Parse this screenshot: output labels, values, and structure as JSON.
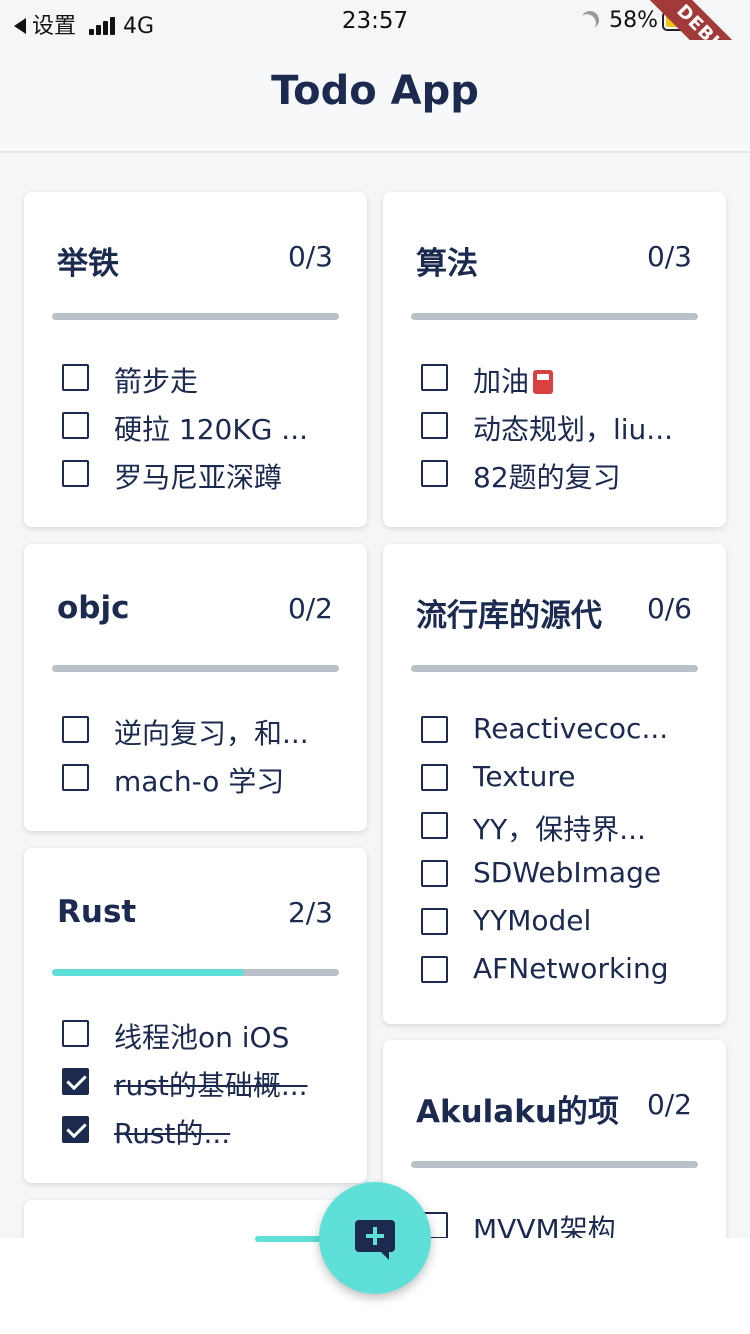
{
  "status_bar": {
    "back_label": "设置",
    "network": "4G",
    "time": "23:57",
    "battery": "58%"
  },
  "debug_banner": "DEBUG",
  "app_bar": {
    "title": "Todo App"
  },
  "colors": {
    "accent": "#5ee0d8",
    "text": "#1b2a4e",
    "progress_bg": "#b9c1c6"
  },
  "cards": [
    {
      "title": "举铁",
      "count": "0/3",
      "progress": 0,
      "items": [
        {
          "text": "箭步走",
          "done": false
        },
        {
          "text": "硬拉 120KG ...",
          "done": false
        },
        {
          "text": "罗马尼亚深蹲",
          "done": false
        }
      ]
    },
    {
      "title": "算法",
      "count": "0/3",
      "progress": 0,
      "items": [
        {
          "text": "加油",
          "done": false
        },
        {
          "text": "动态规划，liu...",
          "done": false
        },
        {
          "text": "82题的复习",
          "done": false
        }
      ]
    },
    {
      "title": "objc",
      "count": "0/2",
      "progress": 0,
      "items": [
        {
          "text": "逆向复习，和...",
          "done": false
        },
        {
          "text": "mach-o 学习",
          "done": false
        }
      ]
    },
    {
      "title": "流行库的源代",
      "count": "0/6",
      "progress": 0,
      "items": [
        {
          "text": "Reactivecoc...",
          "done": false
        },
        {
          "text": "Texture",
          "done": false
        },
        {
          "text": "YY，保持界...",
          "done": false
        },
        {
          "text": "SDWebImage",
          "done": false
        },
        {
          "text": "YYModel",
          "done": false
        },
        {
          "text": "AFNetworking",
          "done": false
        }
      ]
    },
    {
      "title": "Rust",
      "count": "2/3",
      "progress": 0.67,
      "items": [
        {
          "text": "线程池on iOS",
          "done": false
        },
        {
          "text": "rust的基础概...",
          "done": true
        },
        {
          "text": "Rust的...",
          "done": true
        }
      ]
    },
    {
      "title": "Akulaku的项",
      "count": "0/2",
      "progress": 0,
      "items": [
        {
          "text": "MVVM架构",
          "done": false
        }
      ]
    }
  ],
  "fab": {
    "icon": "add-comment-icon"
  }
}
